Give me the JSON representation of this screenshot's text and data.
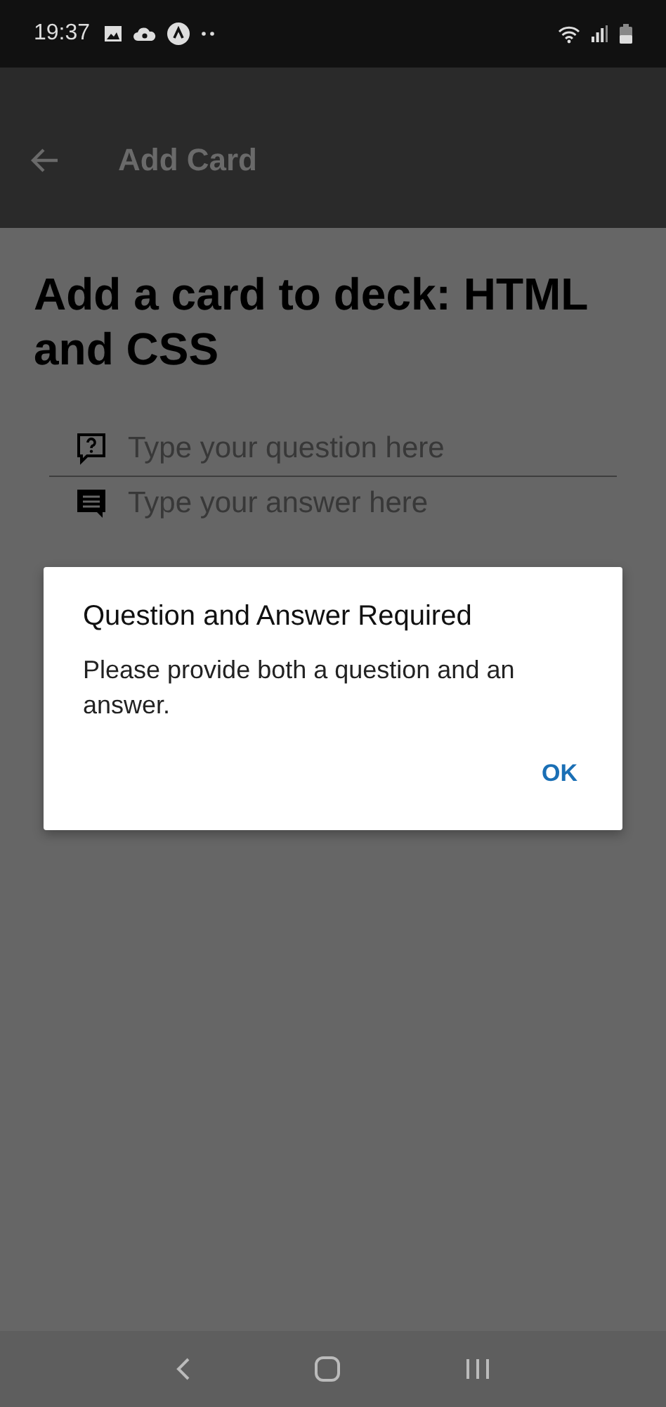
{
  "status_bar": {
    "time": "19:37"
  },
  "app_bar": {
    "title": "Add Card"
  },
  "heading": "Add a card to deck: HTML and CSS",
  "fields": [
    {
      "kind": "question",
      "placeholder": "Type your question here"
    },
    {
      "kind": "answer",
      "placeholder": "Type your answer here"
    }
  ],
  "dialog": {
    "title": "Question and Answer Required",
    "message": "Please provide both a question and an answer.",
    "buttons": [
      "OK"
    ]
  }
}
